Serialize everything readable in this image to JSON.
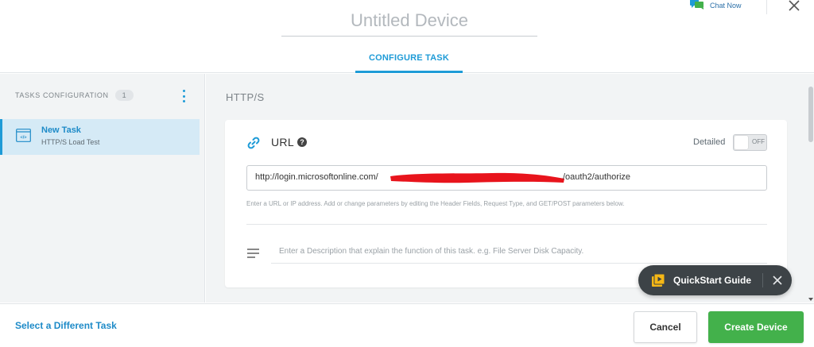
{
  "header": {
    "device_title": "Untitled Device",
    "chat_label": "Chat Now",
    "tab_label": "CONFIGURE TASK"
  },
  "sidebar": {
    "section_label": "TASKS CONFIGURATION",
    "task_count": "1",
    "items": [
      {
        "name": "New Task",
        "type": "HTTP/S Load Test",
        "selected": true
      }
    ]
  },
  "main": {
    "section_title": "HTTP/S",
    "card": {
      "url_label": "URL",
      "detailed_label": "Detailed",
      "toggle_state": "OFF",
      "url_prefix": "http://login.microsoftonline.com/",
      "url_suffix": "/oauth2/authorize",
      "url_hint": "Enter a URL or IP address. Add or change parameters by editing the Header Fields, Request Type, and GET/POST parameters below.",
      "description_placeholder": "Enter a Description that explain the function of this task. e.g. File Server Disk Capacity."
    }
  },
  "footer": {
    "different_task_label": "Select a Different Task",
    "cancel_label": "Cancel",
    "create_label": "Create Device"
  },
  "quickstart": {
    "label": "QuickStart Guide"
  },
  "icons": {
    "chat": "chat-bubbles-icon",
    "close": "close-icon",
    "kebab": "kebab-menu-icon",
    "task": "http-monitor-icon",
    "link": "link-icon",
    "help": "help-icon",
    "description": "text-lines-icon",
    "quickstart": "video-play-icon"
  },
  "colors": {
    "accent": "#1e9bd7",
    "create_button": "#43b14b",
    "redaction": "#e8141c"
  }
}
